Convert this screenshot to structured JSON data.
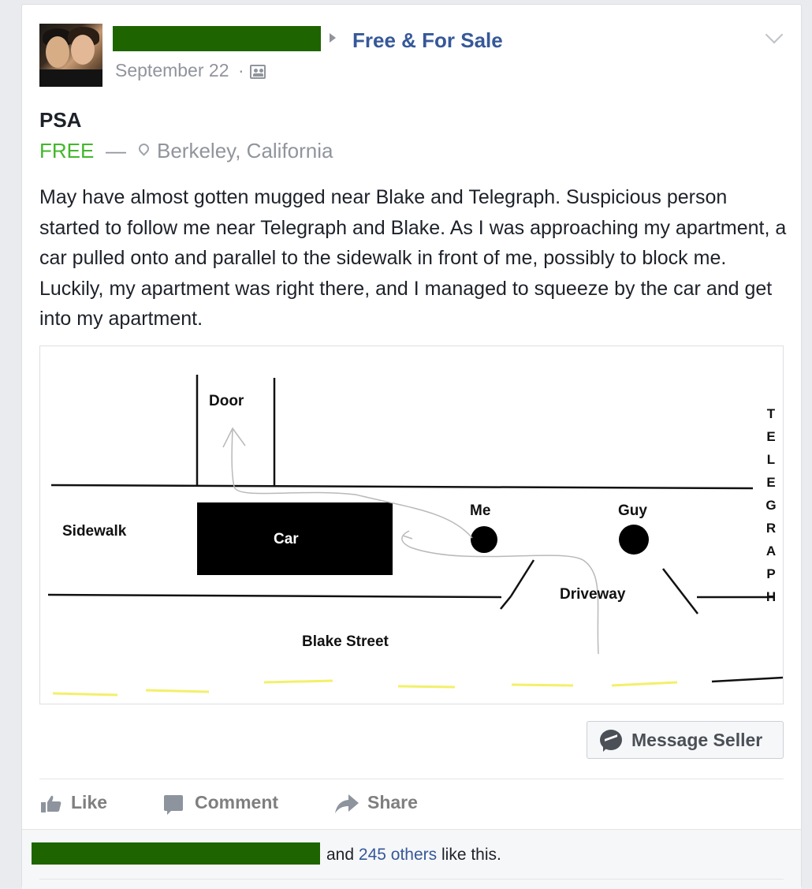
{
  "post": {
    "author_redacted": true,
    "group_name": "Free & For Sale",
    "timestamp": "September 22",
    "separator": "·",
    "audience_icon": "group-audience-icon",
    "title": "PSA",
    "price": "FREE",
    "dash": "—",
    "location_icon": "map-pin-icon",
    "location": "Berkeley, California",
    "body": "May have almost gotten mugged near Blake and Telegraph. Suspicious person started to follow me near Telegraph and Blake. As I was approaching my apartment, a car pulled onto and parallel to the sidewalk in front of me, possibly to block me. Luckily, my apartment was right there, and I managed to squeeze by the car and get into my apartment."
  },
  "diagram": {
    "labels": {
      "door": "Door",
      "sidewalk": "Sidewalk",
      "car": "Car",
      "me": "Me",
      "guy": "Guy",
      "driveway": "Driveway",
      "blake_street": "Blake Street",
      "telegraph_letters": [
        "T",
        "E",
        "L",
        "E",
        "G",
        "R",
        "A",
        "P",
        "H"
      ]
    },
    "colors": {
      "line": "#111111",
      "path": "#b9b9b9",
      "road_marking": "#f2f06a"
    }
  },
  "message_button": {
    "label": "Message Seller",
    "icon": "messenger-icon"
  },
  "actions": {
    "like": "Like",
    "comment": "Comment",
    "share": "Share"
  },
  "footer": {
    "likers_redacted": true,
    "and_text": "and",
    "others_link": "245 others",
    "like_this": "like this."
  },
  "colors": {
    "link_blue": "#365899",
    "free_green": "#42b72a",
    "meta_gray": "#90949c",
    "redaction_green": "#1e6400"
  }
}
